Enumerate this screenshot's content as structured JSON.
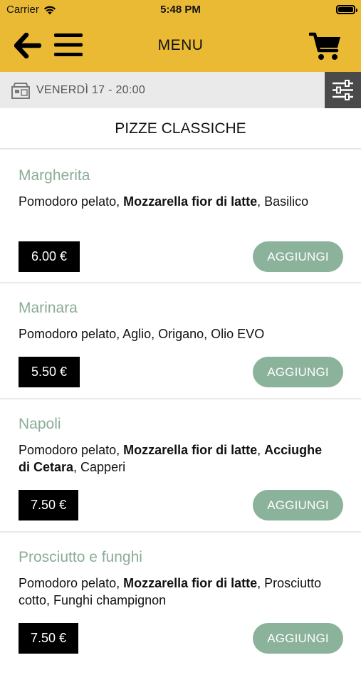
{
  "status": {
    "carrier": "Carrier",
    "time": "5:48 PM"
  },
  "navbar": {
    "title": "MENU"
  },
  "datebar": {
    "text": "VENERDÌ 17 - 20:00"
  },
  "section": {
    "title": "PIZZE CLASSICHE"
  },
  "colors": {
    "header": "#ebba35",
    "accent_green": "#8bb29a",
    "item_name": "#8bac97",
    "filter_bg": "#4a4a4a"
  },
  "items": [
    {
      "name": "Margherita",
      "desc": [
        {
          "t": "Pomodoro pelato, "
        },
        {
          "t": "Mozzarella fior di latte",
          "b": true
        },
        {
          "t": ", Basilico"
        }
      ],
      "price": "6.00 €",
      "add_label": "AGGIUNGI"
    },
    {
      "name": "Marinara",
      "desc": [
        {
          "t": "Pomodoro pelato, Aglio, Origano, Olio EVO"
        }
      ],
      "price": "5.50 €",
      "add_label": "AGGIUNGI"
    },
    {
      "name": "Napoli",
      "desc": [
        {
          "t": "Pomodoro pelato, "
        },
        {
          "t": "Mozzarella fior di latte",
          "b": true
        },
        {
          "t": ", "
        },
        {
          "t": "Acciughe di Cetara",
          "b": true
        },
        {
          "t": ", Capperi"
        }
      ],
      "price": "7.50 €",
      "add_label": "AGGIUNGI"
    },
    {
      "name": "Prosciutto e funghi",
      "desc": [
        {
          "t": "Pomodoro pelato, "
        },
        {
          "t": "Mozzarella fior di latte",
          "b": true
        },
        {
          "t": ", Prosciutto cotto, Funghi champignon"
        }
      ],
      "price": "7.50 €",
      "add_label": "AGGIUNGI"
    }
  ]
}
